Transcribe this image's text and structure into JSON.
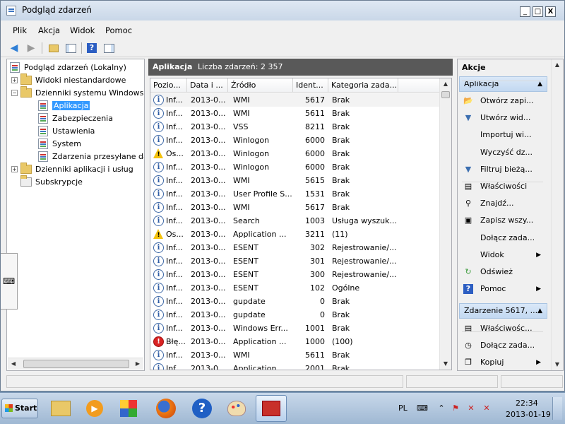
{
  "window": {
    "title": "Podgląd zdarzeń",
    "buttons": {
      "minimize": "_",
      "maximize": "□",
      "close": "X"
    }
  },
  "menu": [
    "Plik",
    "Akcja",
    "Widok",
    "Pomoc"
  ],
  "tree": {
    "items": [
      {
        "label": "Podgląd zdarzeń (Lokalny)"
      },
      {
        "label": "Widoki niestandardowe",
        "expander": "+"
      },
      {
        "label": "Dzienniki systemu Windows",
        "expander": "−"
      },
      {
        "label": "Aplikacja",
        "selected": true
      },
      {
        "label": "Zabezpieczenia"
      },
      {
        "label": "Ustawienia"
      },
      {
        "label": "System"
      },
      {
        "label": "Zdarzenia przesyłane dalej"
      },
      {
        "label": "Dzienniki aplikacji i usług",
        "expander": "+"
      },
      {
        "label": "Subskrypcje"
      }
    ]
  },
  "center": {
    "title": "Aplikacja",
    "count_label": "Liczba zdarzeń: 2 357",
    "columns": [
      "Pozio...",
      "Data i ...",
      "Źródło",
      "Ident...",
      "Kategoria zada..."
    ],
    "rows": [
      {
        "level": "Inf...",
        "type": "info",
        "date": "2013-0...",
        "source": "WMI",
        "id": "5617",
        "category": "Brak"
      },
      {
        "level": "Inf...",
        "type": "info",
        "date": "2013-0...",
        "source": "WMI",
        "id": "5611",
        "category": "Brak"
      },
      {
        "level": "Inf...",
        "type": "info",
        "date": "2013-0...",
        "source": "VSS",
        "id": "8211",
        "category": "Brak"
      },
      {
        "level": "Inf...",
        "type": "info",
        "date": "2013-0...",
        "source": "Winlogon",
        "id": "6000",
        "category": "Brak"
      },
      {
        "level": "Os...",
        "type": "warn",
        "date": "2013-0...",
        "source": "Winlogon",
        "id": "6000",
        "category": "Brak"
      },
      {
        "level": "Inf...",
        "type": "info",
        "date": "2013-0...",
        "source": "Winlogon",
        "id": "6000",
        "category": "Brak"
      },
      {
        "level": "Inf...",
        "type": "info",
        "date": "2013-0...",
        "source": "WMI",
        "id": "5615",
        "category": "Brak"
      },
      {
        "level": "Inf...",
        "type": "info",
        "date": "2013-0...",
        "source": "User Profile S...",
        "id": "1531",
        "category": "Brak"
      },
      {
        "level": "Inf...",
        "type": "info",
        "date": "2013-0...",
        "source": "WMI",
        "id": "5617",
        "category": "Brak"
      },
      {
        "level": "Inf...",
        "type": "info",
        "date": "2013-0...",
        "source": "Search",
        "id": "1003",
        "category": "Usługa wyszuk..."
      },
      {
        "level": "Os...",
        "type": "warn",
        "date": "2013-0...",
        "source": "Application ...",
        "id": "3211",
        "category": "(11)"
      },
      {
        "level": "Inf...",
        "type": "info",
        "date": "2013-0...",
        "source": "ESENT",
        "id": "302",
        "category": "Rejestrowanie/..."
      },
      {
        "level": "Inf...",
        "type": "info",
        "date": "2013-0...",
        "source": "ESENT",
        "id": "301",
        "category": "Rejestrowanie/..."
      },
      {
        "level": "Inf...",
        "type": "info",
        "date": "2013-0...",
        "source": "ESENT",
        "id": "300",
        "category": "Rejestrowanie/..."
      },
      {
        "level": "Inf...",
        "type": "info",
        "date": "2013-0...",
        "source": "ESENT",
        "id": "102",
        "category": "Ogólne"
      },
      {
        "level": "Inf...",
        "type": "info",
        "date": "2013-0...",
        "source": "gupdate",
        "id": "0",
        "category": "Brak"
      },
      {
        "level": "Inf...",
        "type": "info",
        "date": "2013-0...",
        "source": "gupdate",
        "id": "0",
        "category": "Brak"
      },
      {
        "level": "Inf...",
        "type": "info",
        "date": "2013-0...",
        "source": "Windows Err...",
        "id": "1001",
        "category": "Brak"
      },
      {
        "level": "Błę...",
        "type": "err",
        "date": "2013-0...",
        "source": "Application ...",
        "id": "1000",
        "category": "(100)"
      },
      {
        "level": "Inf...",
        "type": "info",
        "date": "2013-0...",
        "source": "WMI",
        "id": "5611",
        "category": "Brak"
      },
      {
        "level": "Inf...",
        "type": "info",
        "date": "2013-0...",
        "source": "Application ...",
        "id": "2001",
        "category": "Brak"
      }
    ]
  },
  "actions": {
    "title": "Akcje",
    "section1": "Aplikacja",
    "items1": [
      {
        "label": "Otwórz zapi...",
        "icon": "open-folder-icon"
      },
      {
        "label": "Utwórz wid...",
        "icon": "filter-create-icon"
      },
      {
        "label": "Importuj wi...",
        "icon": ""
      },
      {
        "label": "Wyczyść dz...",
        "icon": ""
      },
      {
        "label": "Filtruj bieżą...",
        "icon": "filter-icon"
      },
      {
        "label": "Właściwości",
        "icon": "properties-icon"
      },
      {
        "label": "Znajdź...",
        "icon": "find-icon"
      },
      {
        "label": "Zapisz wszy...",
        "icon": "save-icon"
      },
      {
        "label": "Dołącz zada...",
        "icon": ""
      },
      {
        "label": "Widok",
        "icon": "",
        "submenu": true
      },
      {
        "label": "Odśwież",
        "icon": "refresh-icon"
      },
      {
        "label": "Pomoc",
        "icon": "help-icon",
        "submenu": true
      }
    ],
    "section2": "Zdarzenie 5617, ...",
    "items2": [
      {
        "label": "Właściwośc...",
        "icon": "properties-icon"
      },
      {
        "label": "Dołącz zada...",
        "icon": "task-icon"
      },
      {
        "label": "Kopiuj",
        "icon": "copy-icon",
        "submenu": true
      }
    ]
  },
  "taskbar": {
    "start": "Start",
    "lang": "PL",
    "time": "22:34",
    "date": "2013-01-19"
  }
}
